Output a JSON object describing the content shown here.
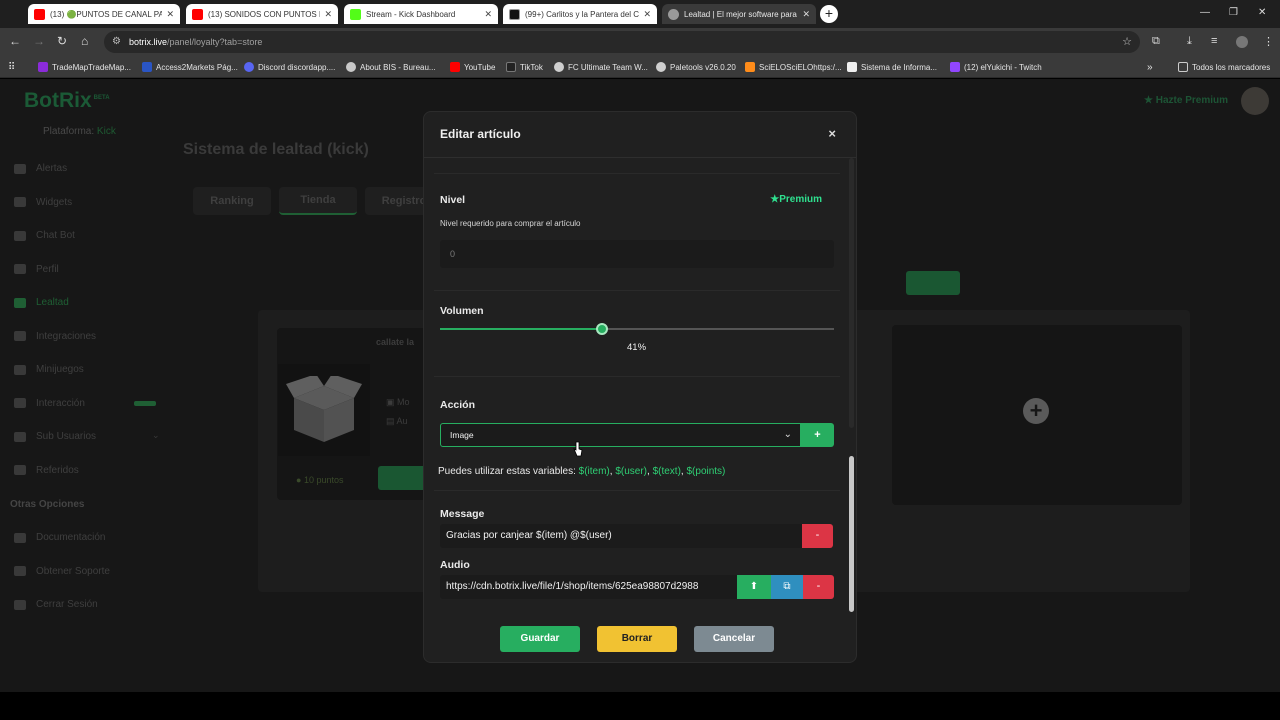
{
  "browser": {
    "tabs": [
      {
        "label": "(13) 🟢PUNTOS DE CANAL PA",
        "color": "#ff0000",
        "active": false
      },
      {
        "label": "(13) SONIDOS CON PUNTOS D",
        "color": "#ff0000",
        "active": false
      },
      {
        "label": "Stream - Kick Dashboard",
        "color": "#53fc18",
        "active": false
      },
      {
        "label": "(99+) Carlitos y la Pantera del C",
        "color": "#111111",
        "active": false
      },
      {
        "label": "Lealtad | El mejor software para",
        "color": "#9a9a9a",
        "active": true
      }
    ],
    "url_host": "botrix.live",
    "url_path": "/panel/loyalty?tab=store",
    "bookmarks": [
      {
        "label": "TradeMapTradeMap...",
        "color": "#8b2bd9"
      },
      {
        "label": "Access2Markets Pág...",
        "color": "#2a55c4"
      },
      {
        "label": "Discord discordapp....",
        "color": "#5865f2"
      },
      {
        "label": "About BIS - Bureau...",
        "color": "#c9c9c9"
      },
      {
        "label": "YouTube",
        "color": "#ff0000"
      },
      {
        "label": "TikTok",
        "color": "#222222"
      },
      {
        "label": "FC Ultimate Team W...",
        "color": "#cfcfcf"
      },
      {
        "label": "Paletools v26.0.20",
        "color": "#cfcfcf"
      },
      {
        "label": "SciELOSciELOhttps:/...",
        "color": "#ff8c1a"
      },
      {
        "label": "Sistema de Informa...",
        "color": "#eeeeee"
      },
      {
        "label": "(12) elYukichi - Twitch",
        "color": "#9146ff"
      }
    ],
    "all_bookmarks": "Todos los marcadores"
  },
  "app": {
    "logo": "BotRix",
    "logo_beta": "BETA",
    "platform_label": "Plataforma:",
    "platform_value": "Kick",
    "premium_link": "Hazte Premium",
    "nav": [
      {
        "label": "Alertas",
        "active": false
      },
      {
        "label": "Widgets",
        "active": false
      },
      {
        "label": "Chat Bot",
        "active": false
      },
      {
        "label": "Perfil",
        "active": false
      },
      {
        "label": "Lealtad",
        "active": true
      },
      {
        "label": "Integraciones",
        "active": false
      },
      {
        "label": "Minijuegos",
        "active": false
      },
      {
        "label": "Interacción",
        "active": false
      },
      {
        "label": "Sub Usuarios",
        "active": false
      },
      {
        "label": "Referidos",
        "active": false
      }
    ],
    "nav_section": "Otras Opciones",
    "nav_other": [
      {
        "label": "Documentación"
      },
      {
        "label": "Obtener Soporte"
      },
      {
        "label": "Cerrar Sesión"
      }
    ],
    "page_title": "Sistema de lealtad (kick)",
    "page_tabs": [
      "Ranking",
      "Tienda",
      "Registro"
    ],
    "card_title": "callate la",
    "card_points": "10 puntos",
    "card_lines": [
      "Mo",
      "Au"
    ]
  },
  "modal": {
    "title": "Editar artículo",
    "close": "×",
    "level": {
      "label": "Nivel",
      "premium": "Premium",
      "help": "Nivel requerido para comprar el artículo",
      "placeholder": "0"
    },
    "volume": {
      "label": "Volumen",
      "value": 0.41,
      "display": "41%"
    },
    "action": {
      "label": "Acción",
      "selected": "Image",
      "add": "+"
    },
    "variables": {
      "prefix": "Puedes utilizar estas variables:",
      "items": [
        "$(item)",
        "$(user)",
        "$(text)",
        "$(points)"
      ],
      "sep": ","
    },
    "message": {
      "label": "Message",
      "value": "Gracias por canjear $(item) @$(user)",
      "remove": "-"
    },
    "audio": {
      "label": "Audio",
      "value": "https://cdn.botrix.live/file/1/shop/items/625ea98807d2988",
      "remove": "-"
    },
    "buttons": {
      "save": "Guardar",
      "delete": "Borrar",
      "cancel": "Cancelar"
    }
  }
}
